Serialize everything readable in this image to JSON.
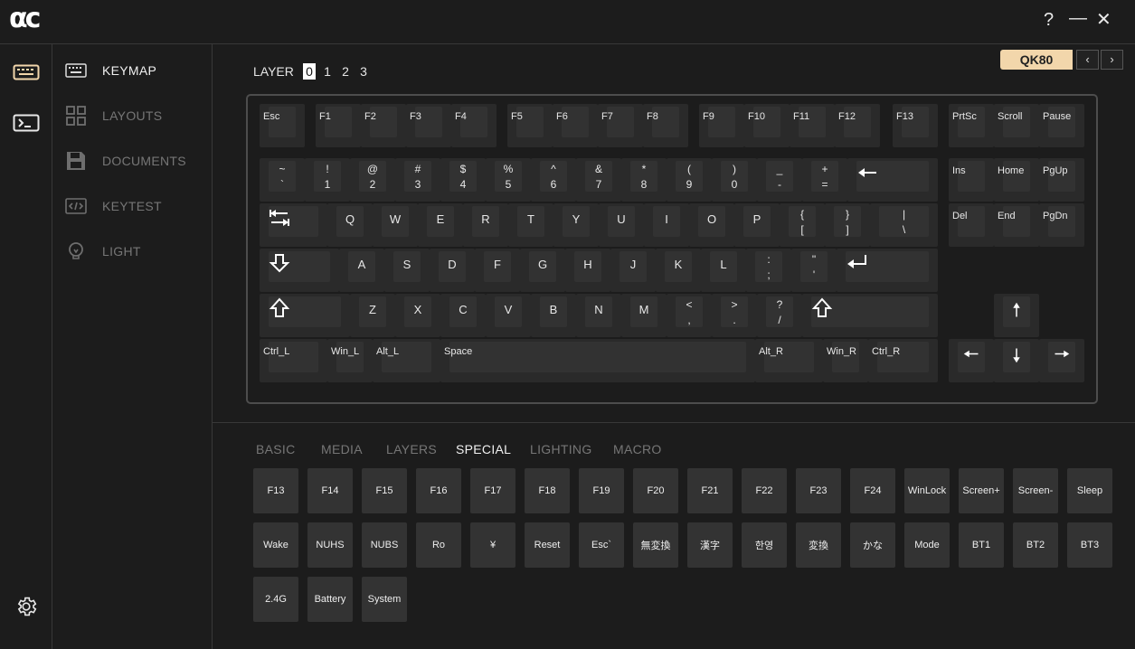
{
  "app": {
    "logo": "αc"
  },
  "window": {
    "help": "?",
    "minimize": "—",
    "close": "✕"
  },
  "sidebar": {
    "items": [
      {
        "label": "KEYMAP",
        "icon": "keyboard-icon",
        "active": true
      },
      {
        "label": "LAYOUTS",
        "icon": "grid-icon",
        "active": false
      },
      {
        "label": "DOCUMENTS",
        "icon": "save-icon",
        "active": false
      },
      {
        "label": "KEYTEST",
        "icon": "code-icon",
        "active": false
      },
      {
        "label": "LIGHT",
        "icon": "bulb-icon",
        "active": false
      }
    ]
  },
  "rail": {
    "icons": [
      "keyboard-icon",
      "terminal-icon",
      "gear-icon"
    ]
  },
  "layer": {
    "label": "LAYER",
    "values": [
      "0",
      "1",
      "2",
      "3"
    ],
    "active": "0"
  },
  "device": {
    "model": "QK80",
    "prev": "‹",
    "next": "›"
  },
  "keyboard": {
    "fn_row": [
      "Esc",
      "F1",
      "F2",
      "F3",
      "F4",
      "F5",
      "F6",
      "F7",
      "F8",
      "F9",
      "F10",
      "F11",
      "F12",
      "F13",
      "PrtSc",
      "Scroll",
      "Pause"
    ],
    "num_row": [
      {
        "top": "~",
        "bottom": "`"
      },
      {
        "top": "!",
        "bottom": "1"
      },
      {
        "top": "@",
        "bottom": "2"
      },
      {
        "top": "#",
        "bottom": "3"
      },
      {
        "top": "$",
        "bottom": "4"
      },
      {
        "top": "%",
        "bottom": "5"
      },
      {
        "top": "^",
        "bottom": "6"
      },
      {
        "top": "&",
        "bottom": "7"
      },
      {
        "top": "*",
        "bottom": "8"
      },
      {
        "top": "(",
        "bottom": "9"
      },
      {
        "top": ")",
        "bottom": "0"
      },
      {
        "top": "_",
        "bottom": "-"
      },
      {
        "top": "+",
        "bottom": "="
      }
    ],
    "letters_q": [
      "Q",
      "W",
      "E",
      "R",
      "T",
      "Y",
      "U",
      "I",
      "O",
      "P"
    ],
    "brackets": [
      {
        "top": "{",
        "bottom": "["
      },
      {
        "top": "}",
        "bottom": "]"
      },
      {
        "top": "|",
        "bottom": "\\"
      }
    ],
    "letters_a": [
      "A",
      "S",
      "D",
      "F",
      "G",
      "H",
      "J",
      "K",
      "L"
    ],
    "home_punct": [
      {
        "top": ":",
        "bottom": ";"
      },
      {
        "top": "\"",
        "bottom": "'"
      }
    ],
    "letters_z": [
      "Z",
      "X",
      "C",
      "V",
      "B",
      "N",
      "M"
    ],
    "bottom_punct": [
      {
        "top": "<",
        "bottom": ","
      },
      {
        "top": ">",
        "bottom": "."
      },
      {
        "top": "?",
        "bottom": "/"
      }
    ],
    "nav_keys": [
      "Ins",
      "Home",
      "PgUp",
      "Del",
      "End",
      "PgDn"
    ],
    "mods": {
      "ctrl_l": "Ctrl_L",
      "win_l": "Win_L",
      "alt_l": "Alt_L",
      "space": "Space",
      "alt_r": "Alt_R",
      "win_r": "Win_R",
      "ctrl_r": "Ctrl_R"
    }
  },
  "panel": {
    "tabs": [
      {
        "label": "BASIC",
        "active": false
      },
      {
        "label": "MEDIA",
        "active": false
      },
      {
        "label": "LAYERS",
        "active": false
      },
      {
        "label": "SPECIAL",
        "active": true
      },
      {
        "label": "LIGHTING",
        "active": false
      },
      {
        "label": "MACRO",
        "active": false
      }
    ],
    "keys": [
      "F13",
      "F14",
      "F15",
      "F16",
      "F17",
      "F18",
      "F19",
      "F20",
      "F21",
      "F22",
      "F23",
      "F24",
      "WinLock",
      "Screen+",
      "Screen-",
      "Sleep",
      "Wake",
      "NUHS",
      "NUBS",
      "Ro",
      "¥",
      "Reset",
      "Esc`",
      "無変換",
      "漢字",
      "한영",
      "変換",
      "かな",
      "Mode",
      "BT1",
      "BT2",
      "BT3",
      "2.4G",
      "Battery",
      "System"
    ]
  },
  "colors": {
    "accent": "#f2d6ab",
    "background": "#1c1c1c",
    "key": "#333333"
  }
}
